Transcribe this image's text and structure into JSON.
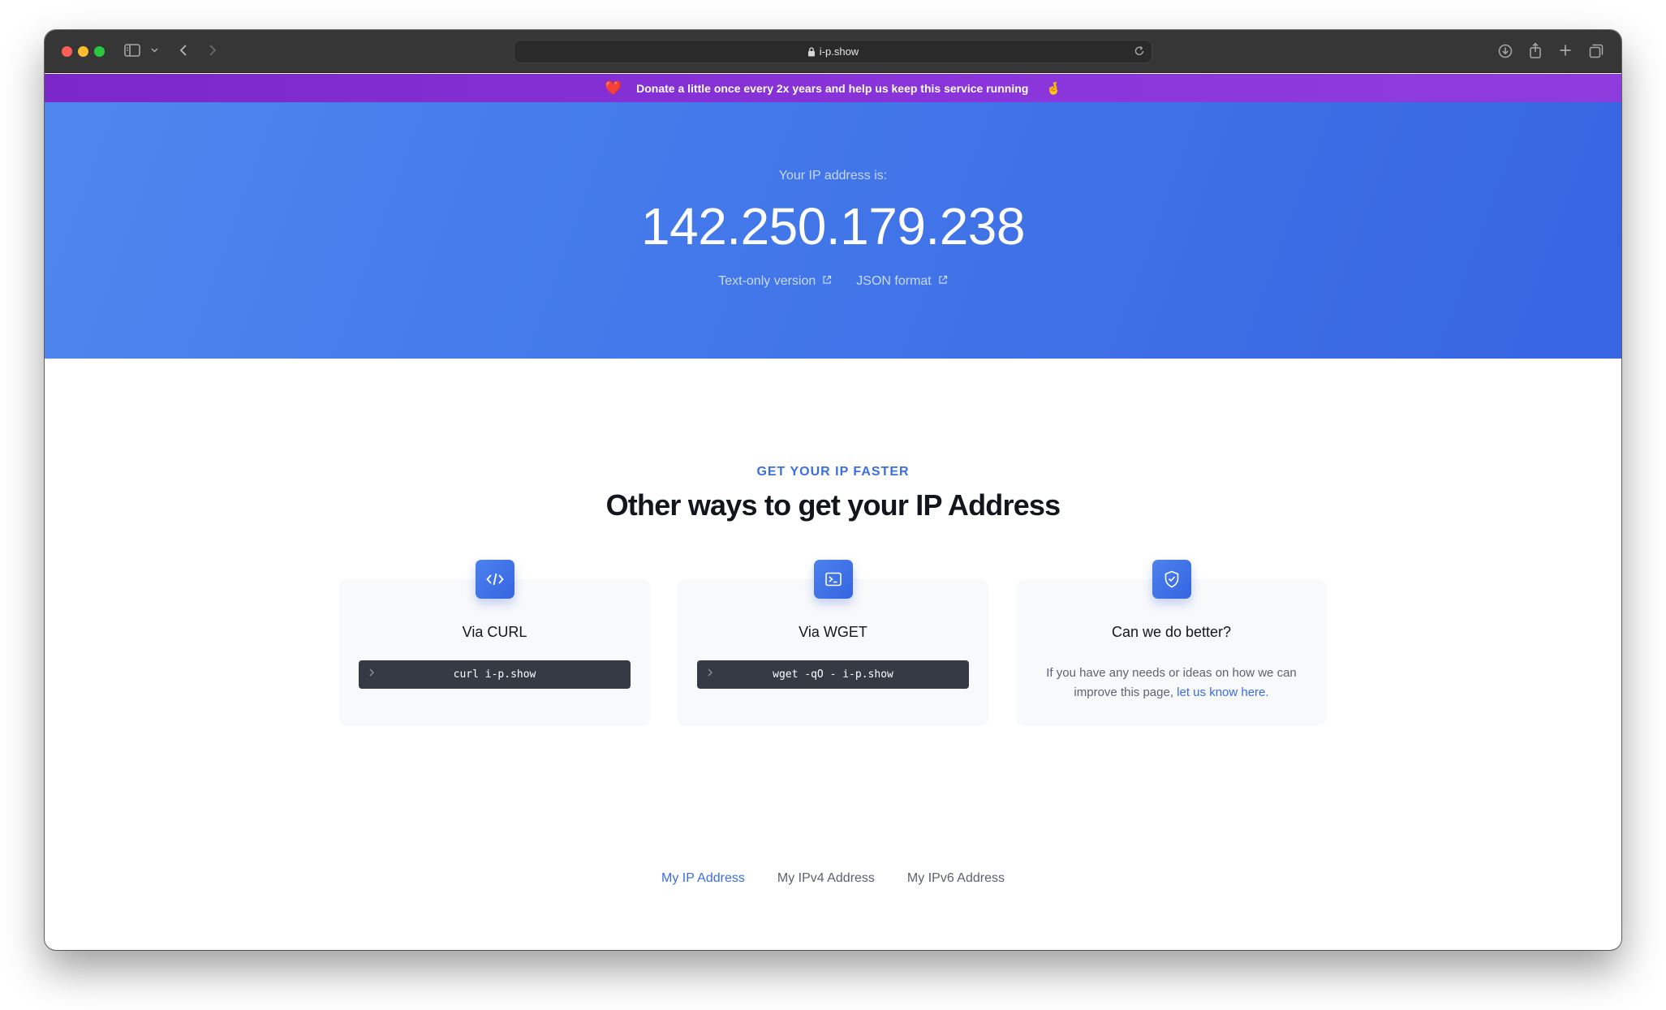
{
  "browser": {
    "url": "i-p.show"
  },
  "banner": {
    "heart": "❤️",
    "text": "Donate a little once every 2x years and help us keep this service running",
    "hand": "🤞"
  },
  "hero": {
    "label": "Your IP address is:",
    "ip": "142.250.179.238",
    "links": [
      {
        "label": "Text-only version"
      },
      {
        "label": "JSON format"
      }
    ]
  },
  "section": {
    "eyebrow": "GET YOUR IP FASTER",
    "heading": "Other ways to get your IP Address"
  },
  "cards": [
    {
      "title": "Via CURL",
      "command": "curl i-p.show",
      "icon": "code-icon"
    },
    {
      "title": "Via WGET",
      "command": "wget -qO - i-p.show",
      "icon": "terminal-icon"
    },
    {
      "title": "Can we do better?",
      "description": "If you have any needs or ideas on how we can improve this page,",
      "link": "let us know here.",
      "icon": "shield-check-icon"
    }
  ],
  "footer": {
    "links": [
      "My IP Address",
      "My IPv4 Address",
      "My IPv6 Address"
    ]
  },
  "colors": {
    "accent": "#3b6fe0",
    "banner": "#8a35db",
    "hero": "#4379ea"
  }
}
